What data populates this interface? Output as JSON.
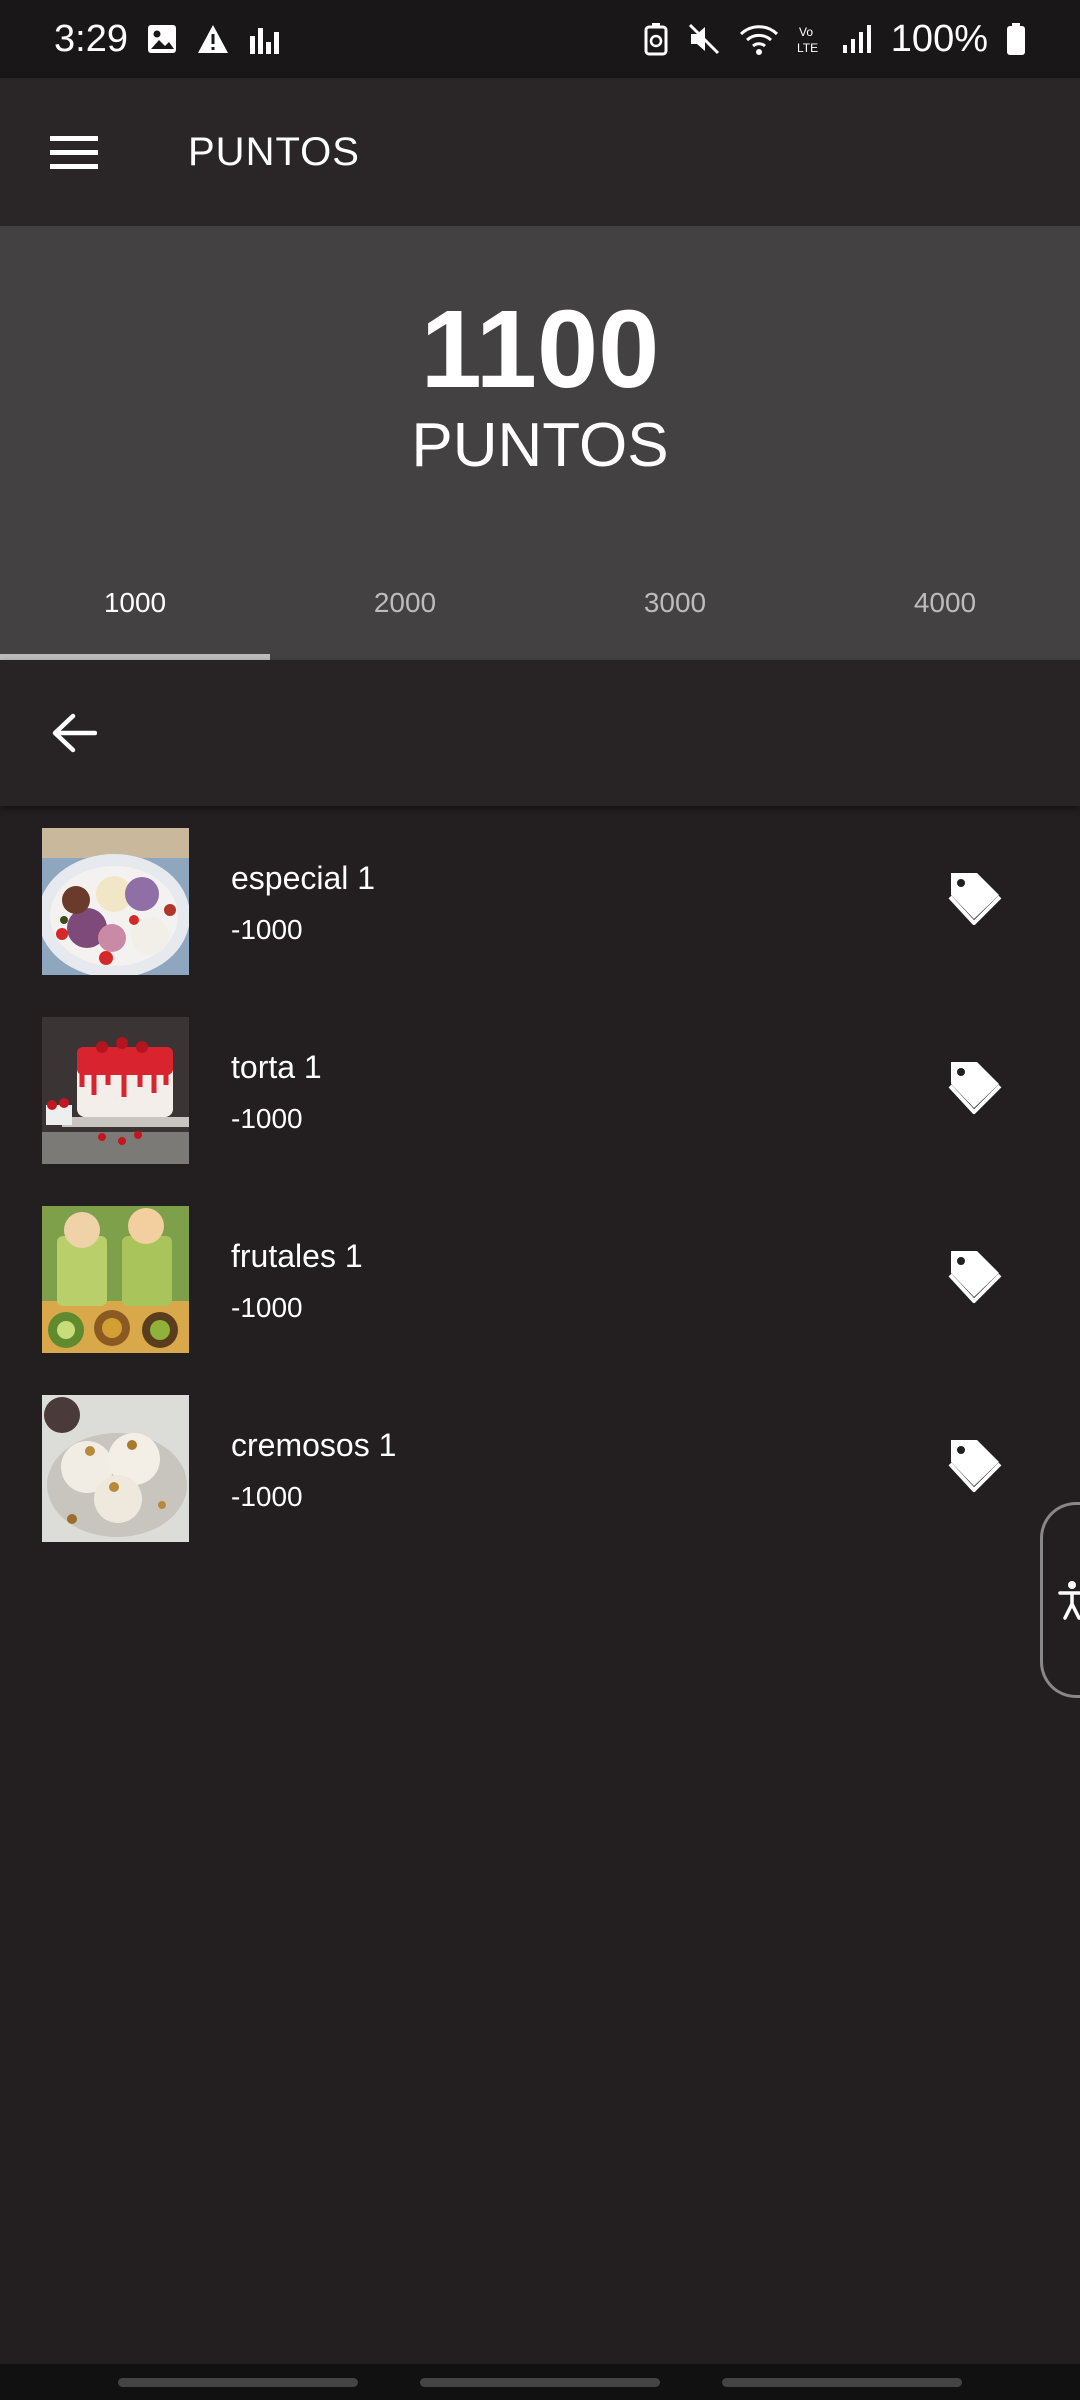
{
  "status_bar": {
    "time": "3:29",
    "battery": "100%"
  },
  "app_bar": {
    "title": "PUNTOS"
  },
  "points": {
    "value": "1100",
    "label": "PUNTOS"
  },
  "tabs": [
    {
      "label": "1000",
      "active": true
    },
    {
      "label": "2000",
      "active": false
    },
    {
      "label": "3000",
      "active": false
    },
    {
      "label": "4000",
      "active": false
    }
  ],
  "items": [
    {
      "name": "especial 1",
      "price": "-1000",
      "image": "ice-cream-bowl"
    },
    {
      "name": "torta 1",
      "price": "-1000",
      "image": "strawberry-cake"
    },
    {
      "name": "frutales 1",
      "price": "-1000",
      "image": "kiwi-cups"
    },
    {
      "name": "cremosos 1",
      "price": "-1000",
      "image": "creamy-ice-cream"
    }
  ],
  "icons": {
    "menu": "menu-icon",
    "back": "arrow-left-icon",
    "tag": "tags-icon",
    "accessibility": "accessibility-icon"
  },
  "colors": {
    "background": "#231f20",
    "panel": "#434142",
    "appbar": "#2a2627"
  }
}
